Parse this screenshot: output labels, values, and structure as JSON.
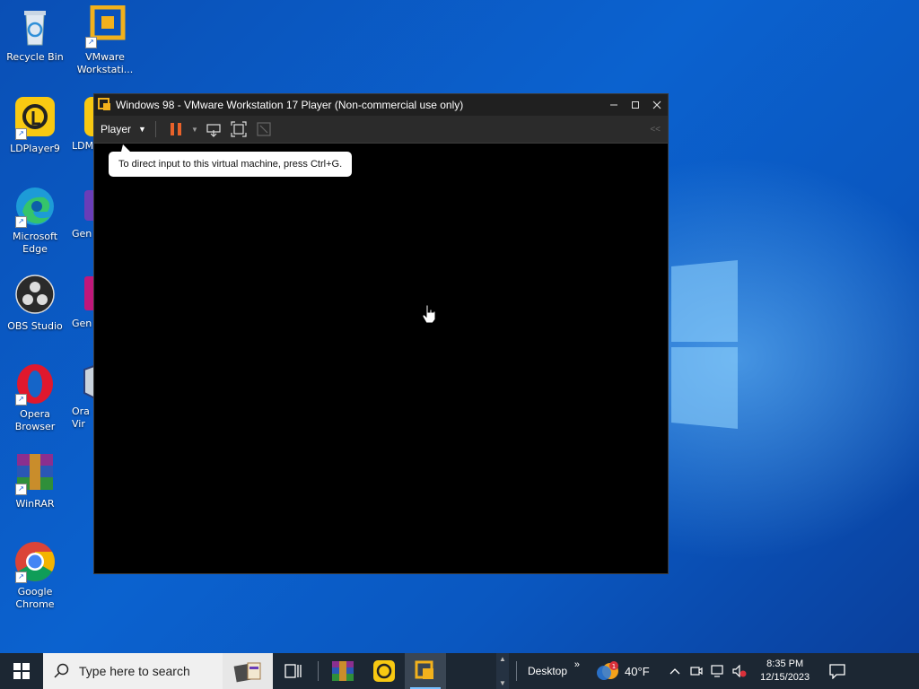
{
  "desktop": {
    "icons": [
      {
        "label": "Recycle Bin"
      },
      {
        "label": "VMware Workstati..."
      },
      {
        "label": "LDPlayer9"
      },
      {
        "label": "LDM"
      },
      {
        "label": "Microsoft Edge"
      },
      {
        "label": "Gen"
      },
      {
        "label": "OBS Studio"
      },
      {
        "label": "Gen"
      },
      {
        "label": "Opera Browser"
      },
      {
        "label": "Ora Vir"
      },
      {
        "label": "WinRAR"
      },
      {
        "label": "Google Chrome"
      }
    ]
  },
  "vmware": {
    "title": "Windows 98 - VMware Workstation 17 Player (Non-commercial use only)",
    "menu_label": "Player",
    "collapse_label": "<<",
    "tooltip": "To direct input to this virtual machine, press Ctrl+G.",
    "colors": {
      "pause": "#e8622a",
      "titlebar": "#202020"
    }
  },
  "taskbar": {
    "search_placeholder": "Type here to search",
    "desktop_label": "Desktop",
    "desktop_chevron": "»",
    "weather_temp": "40°F",
    "weather_badge": "1",
    "time": "8:35 PM",
    "date": "12/15/2023"
  }
}
